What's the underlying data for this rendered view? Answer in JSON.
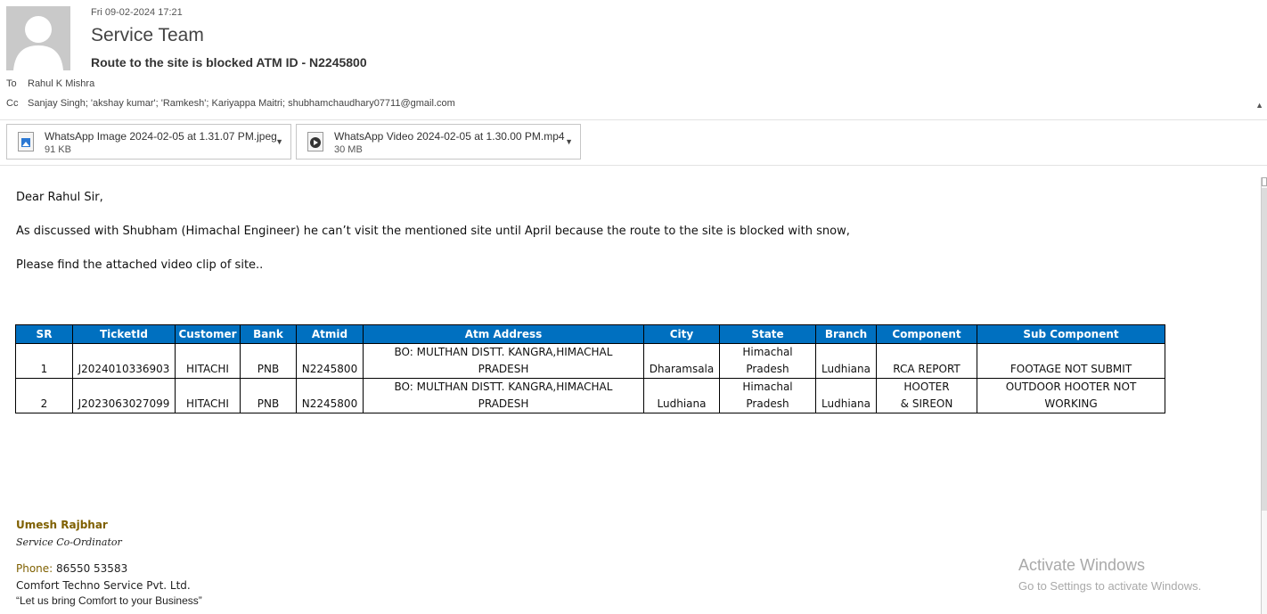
{
  "header": {
    "date": "Fri 09-02-2024 17:21",
    "from": "Service Team",
    "subject": "Route to the site is blocked ATM ID - N2245800",
    "to_label": "To",
    "to_value": "Rahul K Mishra",
    "cc_label": "Cc",
    "cc_value": "Sanjay Singh; 'akshay kumar'; 'Ramkesh'; Kariyappa Maitri; shubhamchaudhary07711@gmail.com"
  },
  "attachments": [
    {
      "name": "WhatsApp Image 2024-02-05 at 1.31.07 PM.jpeg",
      "size": "91 KB",
      "icon": "image-file-icon"
    },
    {
      "name": "WhatsApp Video 2024-02-05 at 1.30.00 PM.mp4",
      "size": "30 MB",
      "icon": "video-file-icon"
    }
  ],
  "body": {
    "greeting": "Dear Rahul Sir,",
    "para1": "As discussed with Shubham (Himachal Engineer) he can’t visit the mentioned site until April because the route to the site is blocked with snow,",
    "para2": "Please find the attached video clip of site.."
  },
  "table": {
    "headers": [
      "SR",
      "TicketId",
      "Customer",
      "Bank",
      "Atmid",
      "Atm Address",
      "City",
      "State",
      "Branch",
      "Component",
      "Sub Component"
    ],
    "rows": [
      [
        "1",
        "J2024010336903",
        "HITACHI",
        "PNB",
        "N2245800",
        "BO: MULTHAN  DISTT. KANGRA,HIMACHAL PRADESH",
        "Dharamsala",
        "Himachal Pradesh",
        "Ludhiana",
        "RCA REPORT",
        "FOOTAGE NOT SUBMIT"
      ],
      [
        "2",
        "J2023063027099",
        "HITACHI",
        "PNB",
        "N2245800",
        "BO: MULTHAN  DISTT. KANGRA,HIMACHAL PRADESH",
        "Ludhiana",
        "Himachal Pradesh",
        "Ludhiana",
        "HOOTER & SIREON",
        "OUTDOOR HOOTER NOT WORKING"
      ]
    ]
  },
  "signature": {
    "name": "Umesh Rajbhar",
    "title": "Service Co-Ordinator",
    "phone_label": "Phone:",
    "phone": "86550 53583",
    "company": "Comfort Techno Service Pvt. Ltd.",
    "tagline": "“Let us bring Comfort to your Business”"
  },
  "watermark": {
    "title": "Activate Windows",
    "subtitle": "Go to Settings to activate Windows."
  },
  "colors": {
    "table_header": "#0070c0",
    "signature_accent": "#7f6000"
  }
}
